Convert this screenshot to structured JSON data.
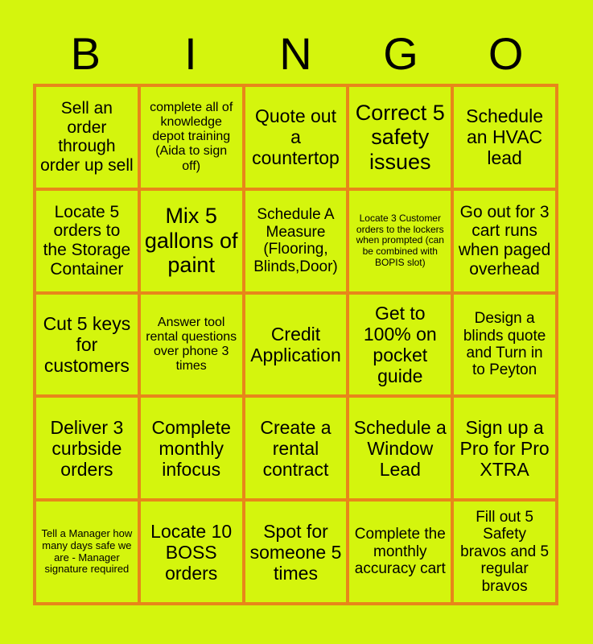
{
  "header": {
    "letters": [
      "B",
      "I",
      "N",
      "G",
      "O"
    ]
  },
  "colors": {
    "background": "#d4f50d",
    "cell_fill": "#d4f50d",
    "border": "#e8861a",
    "text": "#000000"
  },
  "grid": {
    "columns": 5,
    "rows": 5,
    "cells": [
      {
        "text": "Sell an order through order up sell",
        "size": "fs-lg"
      },
      {
        "text": "complete all of knowledge depot training (Aida to sign off)",
        "size": "fs-sm"
      },
      {
        "text": "Quote out a countertop",
        "size": "fs-xl"
      },
      {
        "text": "Correct 5 safety issues",
        "size": "fs-xxl"
      },
      {
        "text": "Schedule an HVAC lead",
        "size": "fs-xl"
      },
      {
        "text": "Locate 5 orders to the Storage Container",
        "size": "fs-lg"
      },
      {
        "text": "Mix 5 gallons of paint",
        "size": "fs-xxl"
      },
      {
        "text": "Schedule A Measure (Flooring, Blinds,Door)",
        "size": "fs-md"
      },
      {
        "text": "Locate 3 Customer orders to the lockers when prompted (can be combined with BOPIS slot)",
        "size": "fs-xxs"
      },
      {
        "text": "Go out for 3 cart runs when paged overhead",
        "size": "fs-lg"
      },
      {
        "text": "Cut 5 keys for customers",
        "size": "fs-xl"
      },
      {
        "text": "Answer tool rental questions over phone 3 times",
        "size": "fs-sm"
      },
      {
        "text": "Credit Application",
        "size": "fs-xl"
      },
      {
        "text": "Get to 100% on pocket guide",
        "size": "fs-xl"
      },
      {
        "text": "Design a blinds quote and Turn in to Peyton",
        "size": "fs-md"
      },
      {
        "text": "Deliver 3 curbside orders",
        "size": "fs-xl"
      },
      {
        "text": "Complete monthly infocus",
        "size": "fs-xl"
      },
      {
        "text": "Create a rental contract",
        "size": "fs-xl"
      },
      {
        "text": "Schedule a Window Lead",
        "size": "fs-xl"
      },
      {
        "text": "Sign up a Pro for Pro XTRA",
        "size": "fs-xl"
      },
      {
        "text": "Tell a Manager how many days safe we are - Manager signature required",
        "size": "fs-xs"
      },
      {
        "text": "Locate 10 BOSS orders",
        "size": "fs-xl"
      },
      {
        "text": "Spot for someone 5 times",
        "size": "fs-xl"
      },
      {
        "text": "Complete the monthly accuracy cart",
        "size": "fs-md"
      },
      {
        "text": "Fill out 5 Safety bravos and 5 regular bravos",
        "size": "fs-md"
      }
    ]
  }
}
